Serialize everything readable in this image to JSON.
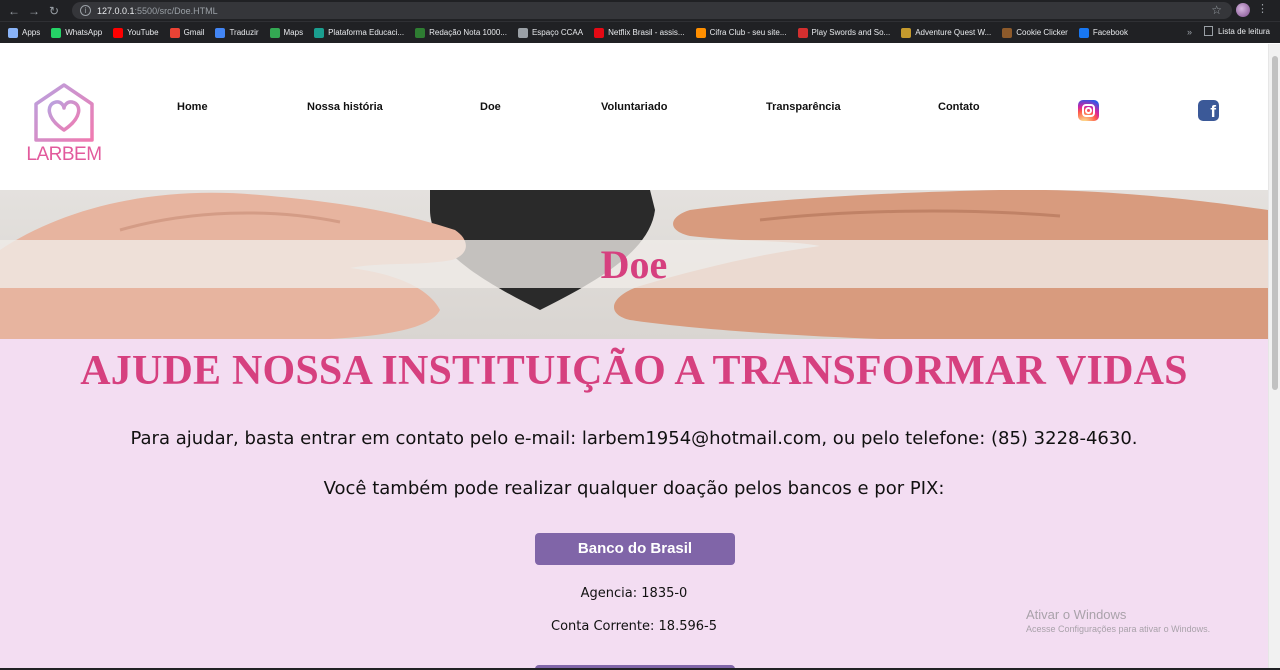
{
  "browser": {
    "url_host": "127.0.0.1",
    "url_path": ":5500/src/Doe.HTML"
  },
  "bookmarks": [
    {
      "label": "Apps",
      "icon": "apps-grid-icon",
      "color": "#8ab4f8"
    },
    {
      "label": "WhatsApp",
      "icon": "whatsapp-icon",
      "color": "#25d366"
    },
    {
      "label": "YouTube",
      "icon": "youtube-icon",
      "color": "#ff0000"
    },
    {
      "label": "Gmail",
      "icon": "gmail-icon",
      "color": "#ea4335"
    },
    {
      "label": "Traduzir",
      "icon": "translate-icon",
      "color": "#4285f4"
    },
    {
      "label": "Maps",
      "icon": "maps-pin-icon",
      "color": "#34a853"
    },
    {
      "label": "Plataforma Educaci...",
      "icon": "platform-icon",
      "color": "#1a9e8f"
    },
    {
      "label": "Redação Nota 1000...",
      "icon": "check-icon",
      "color": "#2e7d32"
    },
    {
      "label": "Espaço CCAA",
      "icon": "globe-icon",
      "color": "#9aa0a6"
    },
    {
      "label": "Netflix Brasil - assis...",
      "icon": "netflix-icon",
      "color": "#e50914"
    },
    {
      "label": "Cifra Club - seu site...",
      "icon": "cifra-club-icon",
      "color": "#ff8f00"
    },
    {
      "label": "Play Swords and So...",
      "icon": "kongregate-icon",
      "color": "#d32f2f"
    },
    {
      "label": "Adventure Quest W...",
      "icon": "aqw-icon",
      "color": "#c59a2d"
    },
    {
      "label": "Cookie Clicker",
      "icon": "cookie-icon",
      "color": "#8d5a2b"
    },
    {
      "label": "Facebook",
      "icon": "facebook-icon",
      "color": "#1877f2"
    }
  ],
  "bookmarks_more": "»",
  "reading_list": "Lista de leitura",
  "logo": {
    "text": "LARBEM"
  },
  "nav": [
    {
      "label": "Home"
    },
    {
      "label": "Nossa história"
    },
    {
      "label": "Doe"
    },
    {
      "label": "Voluntariado"
    },
    {
      "label": "Transparência"
    },
    {
      "label": "Contato"
    }
  ],
  "hero": {
    "title": "Doe"
  },
  "content": {
    "headline": "AJUDE NOSSA INSTITUIÇÃO A TRANSFORMAR VIDAS",
    "contact_text": "Para ajudar, basta entrar em contato pelo e-mail: larbem1954@hotmail.com, ou pelo telefone: (85) 3228-4630.",
    "banks_text": "Você também pode realizar qualquer doação pelos bancos e por PIX:",
    "bank": {
      "name": "Banco do Brasil",
      "agency": "Agencia: 1835-0",
      "account": "Conta Corrente: 18.596-5"
    }
  },
  "watermark": {
    "title": "Ativar o Windows",
    "subtitle": "Acesse Configurações para ativar o Windows."
  },
  "colors": {
    "brand_pink": "#d6407f",
    "button_purple": "#8065a8",
    "content_bg": "#f3ddf2"
  }
}
